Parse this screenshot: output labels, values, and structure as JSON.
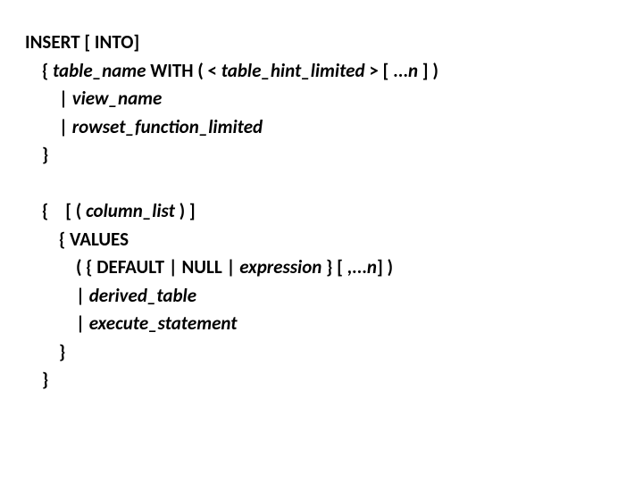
{
  "lines": {
    "l1a": "INSERT [ INTO]",
    "l2a": "    { ",
    "l2b": "table_name",
    "l2c": " WITH ( < ",
    "l2d": "table_hint_limited",
    "l2e": " > [ ...",
    "l2f": "n",
    "l2g": " ] )",
    "l3a": "        | ",
    "l3b": "view_name",
    "l4a": "        | ",
    "l4b": "rowset_function_limited",
    "l5a": "    }",
    "l6a": " ",
    "l7a": "    {    [ ( ",
    "l7b": "column_list",
    "l7c": " ) ]",
    "l8a": "        { VALUES",
    "l9a": "            ( { DEFAULT | NULL | ",
    "l9b": "expression",
    "l9c": " } [ ,...",
    "l9d": "n",
    "l9e": "] )",
    "l10a": "            | ",
    "l10b": "derived_table",
    "l11a": "            | ",
    "l11b": "execute_statement",
    "l12a": "        }",
    "l13a": "    }"
  }
}
